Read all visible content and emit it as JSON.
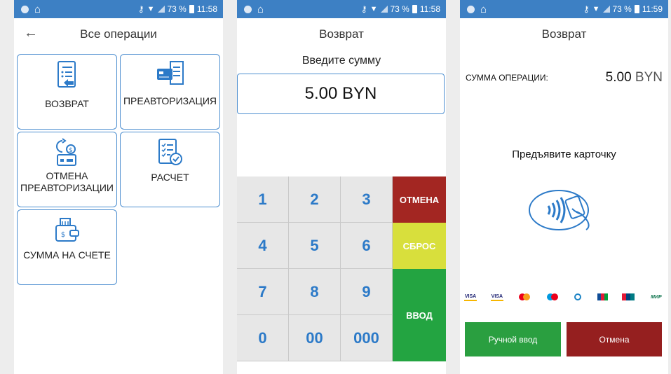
{
  "colors": {
    "statusbar": "#3d80c4",
    "accent": "#2c7ac8",
    "cancel": "#a32622",
    "reset": "#d8df3c",
    "enter": "#23a441",
    "manual": "#2a9f40",
    "cancel_btn": "#951f1f"
  },
  "screens": [
    {
      "status": {
        "battery": "73 %",
        "time": "11:58"
      },
      "title": "Все операции",
      "tiles": [
        {
          "label": "ВОЗВРАТ",
          "icon": "refund-doc-icon"
        },
        {
          "label": "ПРЕАВТОРИЗАЦИЯ",
          "icon": "card-receipt-icon"
        },
        {
          "label": "ОТМЕНА ПРЕАВТОРИЗАЦИИ",
          "icon": "cancel-preauth-icon"
        },
        {
          "label": "РАСЧЕТ",
          "icon": "checklist-icon"
        },
        {
          "label": "СУММА НА СЧЕТЕ",
          "icon": "wallet-icon"
        }
      ]
    },
    {
      "status": {
        "battery": "73 %",
        "time": "11:58"
      },
      "title": "Возврат",
      "prompt": "Введите сумму",
      "amount": "5.00 BYN",
      "keys": [
        "1",
        "2",
        "3",
        "4",
        "5",
        "6",
        "7",
        "8",
        "9",
        "0",
        "00",
        "000"
      ],
      "cancel_label": "ОТМЕНА",
      "reset_label": "СБРОС",
      "enter_label": "ВВОД"
    },
    {
      "status": {
        "battery": "73 %",
        "time": "11:59"
      },
      "title": "Возврат",
      "sum_label": "СУММА ОПЕРАЦИИ:",
      "sum_value": "5.00",
      "sum_currency": "BYN",
      "present": "Предъявите карточку",
      "logos": [
        "VISA",
        "VISA",
        "Mastercard",
        "Maestro",
        "Белкарт",
        "JCB",
        "UnionPay",
        "МИР"
      ],
      "manual_label": "Ручной ввод",
      "cancel_label": "Отмена"
    }
  ]
}
